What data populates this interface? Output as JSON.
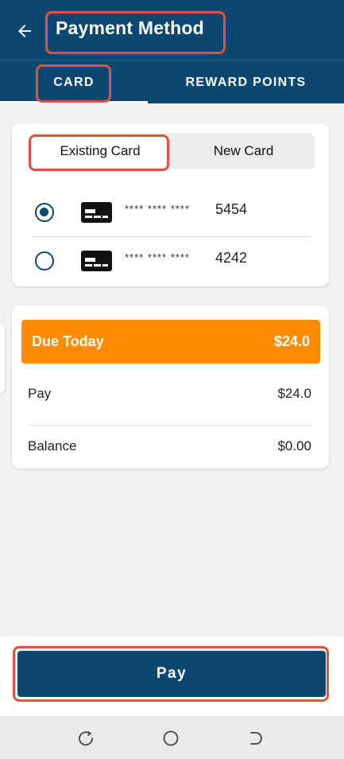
{
  "header": {
    "title": "Payment Method",
    "back_icon": "arrow-left-icon"
  },
  "tabs": [
    {
      "label": "CARD",
      "active": true
    },
    {
      "label": "REWARD POINTS",
      "active": false
    }
  ],
  "card_selector": {
    "existing_label": "Existing Card",
    "new_label": "New Card",
    "selected": "Existing Card"
  },
  "cards": [
    {
      "mask": "**** **** ****",
      "last4": "5454",
      "selected": true
    },
    {
      "mask": "**** **** ****",
      "last4": "4242",
      "selected": false
    }
  ],
  "summary": {
    "due_label": "Due Today",
    "due_value": "$24.0",
    "pay_label": "Pay",
    "pay_value": "$24.0",
    "balance_label": "Balance",
    "balance_value": "$0.00"
  },
  "actions": {
    "pay_label": "Pay"
  },
  "colors": {
    "primary": "#0b4770",
    "accent": "#ff8c00",
    "highlight": "#e0533d"
  }
}
